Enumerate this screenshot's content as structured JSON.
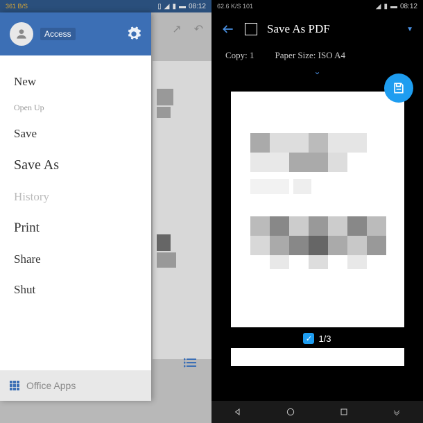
{
  "left": {
    "status": {
      "speed": "361 B/S",
      "time": "08:12"
    },
    "drawer": {
      "access": "Access",
      "menu": {
        "new": "New",
        "open": "Open Up",
        "save": "Save",
        "save_as": "Save As",
        "history": "History",
        "print": "Print",
        "share": "Share",
        "shut": "Shut"
      },
      "footer": "Office Apps"
    }
  },
  "right": {
    "status": {
      "speed": "62.6 K/S 101",
      "time": "08:12"
    },
    "title": "Save As PDF",
    "copy_label": "Copy: 1",
    "paper_label": "Paper Size: ISO A4",
    "page_indicator": "1/3"
  }
}
